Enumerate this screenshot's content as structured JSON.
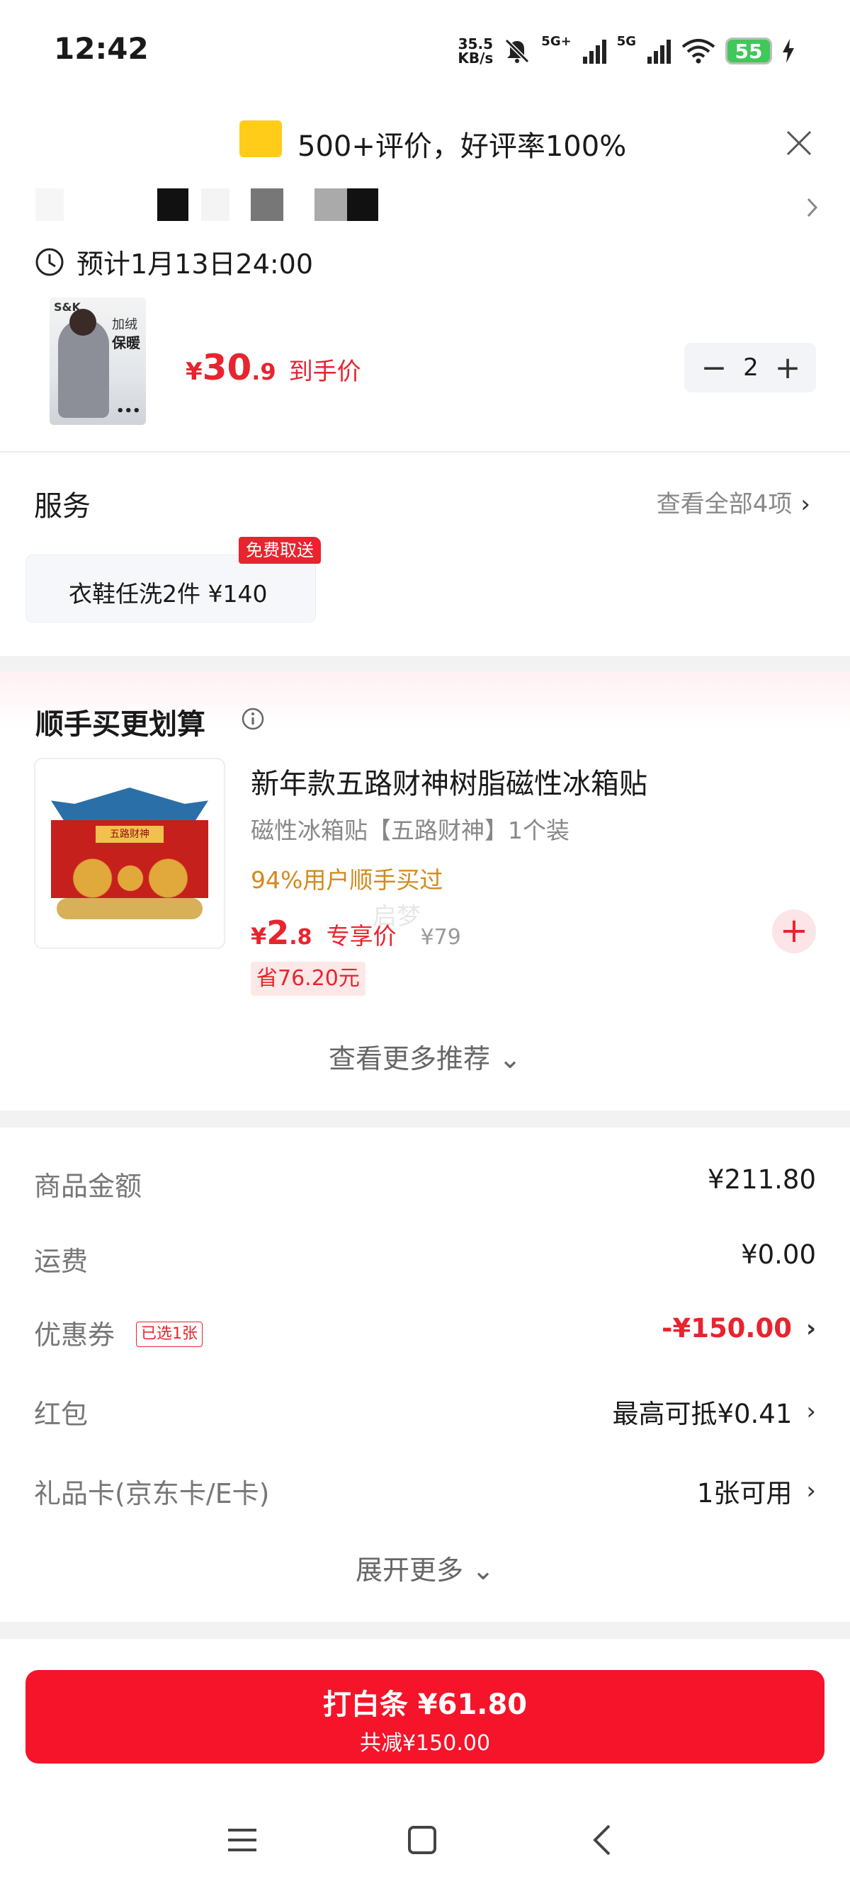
{
  "status_bar": {
    "time": "12:42",
    "net_speed_top": "35.5",
    "net_speed_bottom": "KB/s",
    "sig1": "5G+",
    "sig2": "5G",
    "battery": "55"
  },
  "review_banner": {
    "text": "500+评价，好评率100%"
  },
  "delivery": {
    "text": "预计1月13日24:00"
  },
  "product": {
    "thumb_brand": "S&K",
    "thumb_line1": "加绒",
    "thumb_line2": "保暖",
    "thumb_more": "•••",
    "price_currency": "¥",
    "price_int": "30",
    "price_dec": ".9",
    "price_label": "到手价",
    "quantity": "2",
    "minus": "−",
    "plus": "+"
  },
  "services": {
    "title": "服务",
    "see_all": "查看全部4项",
    "see_all_arrow": "›",
    "card_text": "衣鞋任洗2件  ¥140",
    "badge": "免费取送"
  },
  "recommend": {
    "title": "顺手买更划算",
    "item": {
      "image_sign": "五路财神",
      "name": "新年款五路财神树脂磁性冰箱贴",
      "spec": "磁性冰箱贴【五路财神】1个装",
      "bought": "94%用户顺手买过",
      "price_currency": "¥",
      "price_int": "2",
      "price_dec": ".8",
      "price_label": "专享价",
      "orig_price": "¥79",
      "save": "省76.20元",
      "add": "+"
    },
    "see_more": "查看更多推荐 ⌄",
    "watermark": "启梦"
  },
  "summary": {
    "rows": [
      {
        "label": "商品金额",
        "value": "¥211.80"
      },
      {
        "label": "运费",
        "value": "¥0.00"
      },
      {
        "label": "优惠券",
        "chip": "已选1张",
        "value": "-¥150.00",
        "arrow": "›"
      },
      {
        "label": "红包",
        "value": "最高可抵¥0.41",
        "arrow": "›"
      },
      {
        "label": "礼品卡(京东卡/E卡)",
        "value": "1张可用",
        "arrow": "›"
      }
    ],
    "expand_more": "展开更多 ⌄"
  },
  "pay": {
    "line1": "打白条 ¥61.80",
    "line2": "共减¥150.00"
  },
  "colors": {
    "accent": "#e8242f",
    "button": "#f5142a",
    "bought": "#d4891b",
    "battery": "#42c75a",
    "review_icon": "#ffcc1a"
  }
}
